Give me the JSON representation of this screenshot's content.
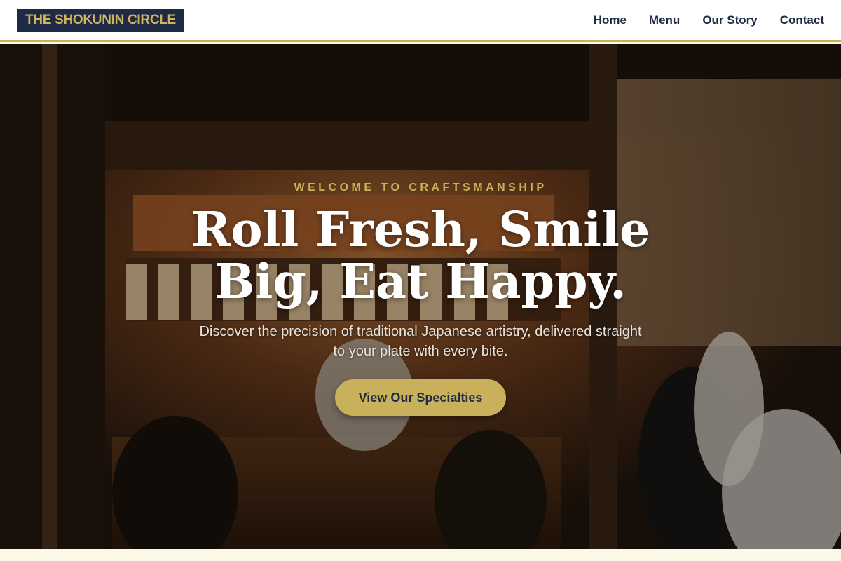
{
  "header": {
    "logo": "THE SHOKUNIN CIRCLE",
    "nav": [
      {
        "label": "Home"
      },
      {
        "label": "Menu"
      },
      {
        "label": "Our Story"
      },
      {
        "label": "Contact"
      }
    ]
  },
  "hero": {
    "eyebrow": "WELCOME TO CRAFTSMANSHIP",
    "headline": "Roll Fresh, Smile Big, Eat Happy.",
    "subtext": "Discover the precision of traditional Japanese artistry, delivered straight to your plate with every bite.",
    "cta_label": "View Our Specialties"
  },
  "colors": {
    "accent_gold": "#c9b15b",
    "navy": "#1f2a44",
    "cream": "#fbf8e6"
  }
}
